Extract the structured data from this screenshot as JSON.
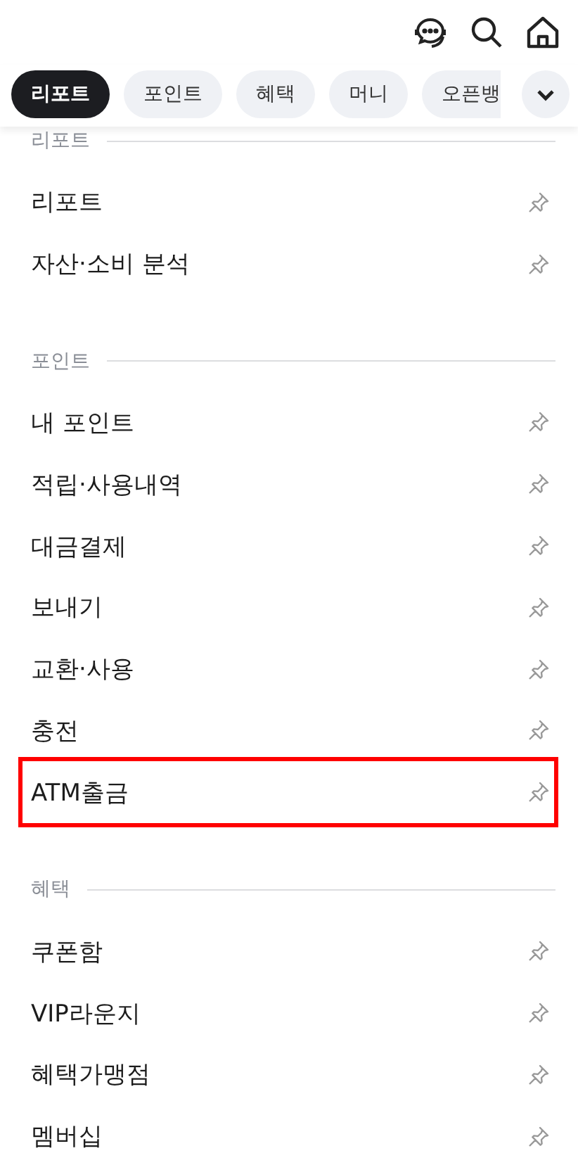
{
  "tabs": [
    {
      "label": "리포트",
      "selected": true
    },
    {
      "label": "포인트",
      "selected": false
    },
    {
      "label": "혜택",
      "selected": false
    },
    {
      "label": "머니",
      "selected": false
    },
    {
      "label": "오픈뱅",
      "selected": false
    }
  ],
  "sections": [
    {
      "title": "리포트",
      "items": [
        {
          "label": "리포트",
          "highlighted": false
        },
        {
          "label": "자산·소비 분석",
          "highlighted": false
        }
      ]
    },
    {
      "title": "포인트",
      "items": [
        {
          "label": "내 포인트",
          "highlighted": false
        },
        {
          "label": "적립·사용내역",
          "highlighted": false
        },
        {
          "label": "대금결제",
          "highlighted": false
        },
        {
          "label": "보내기",
          "highlighted": false
        },
        {
          "label": "교환·사용",
          "highlighted": false
        },
        {
          "label": "충전",
          "highlighted": false
        },
        {
          "label": "ATM출금",
          "highlighted": true
        }
      ]
    },
    {
      "title": "혜택",
      "items": [
        {
          "label": "쿠폰함",
          "highlighted": false
        },
        {
          "label": "VIP라운지",
          "highlighted": false
        },
        {
          "label": "혜택가맹점",
          "highlighted": false
        },
        {
          "label": "멤버십",
          "highlighted": false
        }
      ]
    }
  ]
}
